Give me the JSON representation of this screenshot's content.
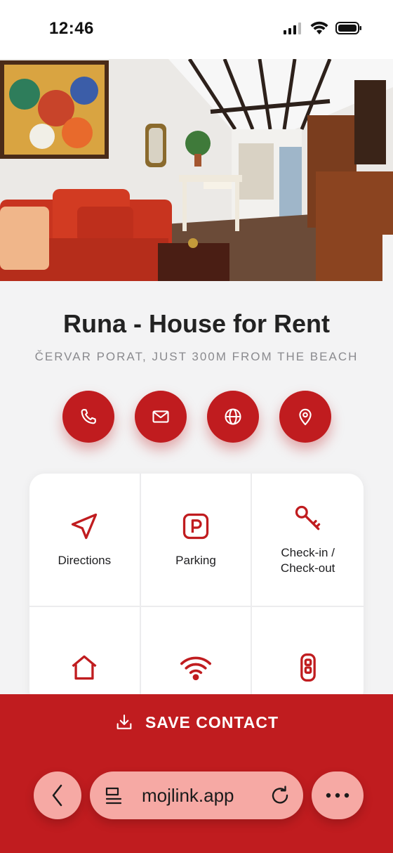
{
  "status_bar": {
    "time": "12:46"
  },
  "hero": {
    "image": "living-room-photo"
  },
  "listing": {
    "title": "Runa - House for Rent",
    "subtitle": "ČERVAR PORAT, JUST 300M FROM THE BEACH"
  },
  "contact_actions": [
    {
      "icon": "phone-icon"
    },
    {
      "icon": "mail-icon"
    },
    {
      "icon": "globe-icon"
    },
    {
      "icon": "location-pin-icon"
    }
  ],
  "tiles": [
    {
      "label": "Directions",
      "icon": "navigation-arrow-icon"
    },
    {
      "label": "Parking",
      "icon": "parking-icon"
    },
    {
      "label": "Check-in /\nCheck-out",
      "icon": "key-icon"
    },
    {
      "label": "",
      "icon": "home-icon"
    },
    {
      "label": "",
      "icon": "wifi-icon"
    },
    {
      "label": "",
      "icon": "remote-icon"
    }
  ],
  "save_contact": {
    "label": "SAVE CONTACT",
    "icon": "download-icon"
  },
  "browser": {
    "url": "mojlink.app"
  },
  "colors": {
    "accent": "#c01c1f",
    "pill": "#f6a9a4",
    "background": "#f3f3f4"
  }
}
